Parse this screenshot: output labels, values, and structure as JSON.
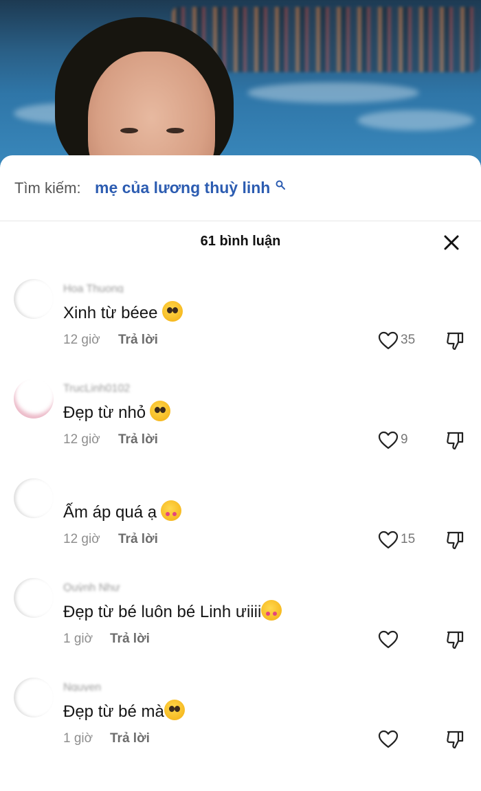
{
  "search": {
    "prefix": "Tìm kiếm:",
    "query": "mẹ của lương thuỳ linh"
  },
  "header": {
    "count_label": "61 bình luận"
  },
  "comments": [
    {
      "username": "Hoa Thuong",
      "text": "Xinh từ béee",
      "emoji": "pleading-face",
      "time": "12 giờ",
      "reply": "Trả lời",
      "likes": "35"
    },
    {
      "username": "TrucLinh0102",
      "text": "Đẹp từ nhỏ",
      "emoji": "rolling-eyes-face",
      "time": "12 giờ",
      "reply": "Trả lời",
      "likes": "9"
    },
    {
      "username": "",
      "text": "Ấm áp quá ạ",
      "emoji": "smiling-face-with-hearts",
      "time": "12 giờ",
      "reply": "Trả lời",
      "likes": "15"
    },
    {
      "username": "Quỳnh Như",
      "text": "Đẹp từ bé luôn bé Linh ưiiii",
      "emoji": "smiling-face-with-hearts",
      "time": "1 giờ",
      "reply": "Trả lời",
      "likes": ""
    },
    {
      "username": "Nguyen",
      "text": "Đẹp từ bé mà",
      "emoji": "flushed-face",
      "time": "1 giờ",
      "reply": "Trả lời",
      "likes": ""
    }
  ],
  "colors": {
    "query": "#2c5cb1",
    "meta": "#8e8e8e"
  }
}
